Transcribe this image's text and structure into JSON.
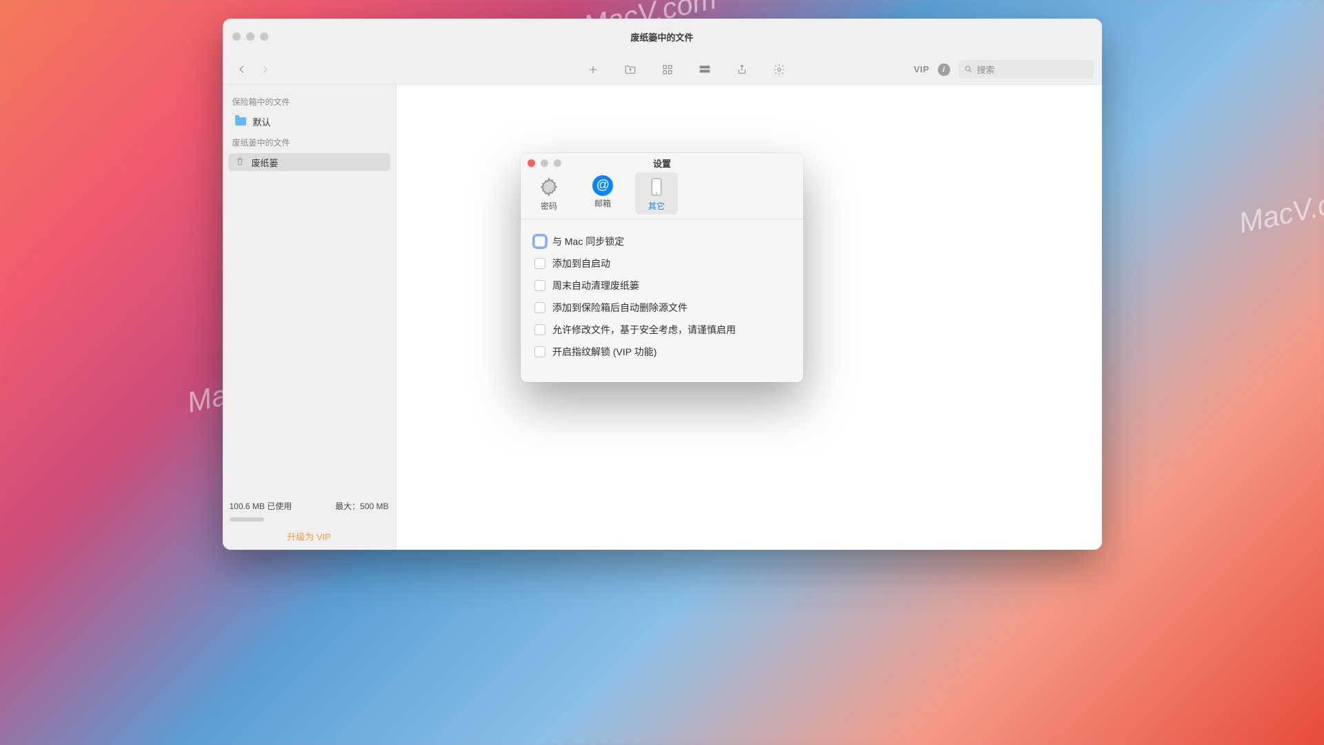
{
  "window": {
    "title": "废纸篓中的文件"
  },
  "toolbar": {
    "vip": "VIP",
    "search_placeholder": "搜索"
  },
  "sidebar": {
    "section_vault": "保险箱中的文件",
    "section_trash": "废纸篓中的文件",
    "item_default": "默认",
    "item_trash": "废纸篓",
    "usage_used": "100.6 MB 已使用",
    "usage_max": "最大：500 MB",
    "upgrade": "升级为 VIP"
  },
  "dialog": {
    "title": "设置",
    "tabs": {
      "password": "密码",
      "mail": "邮箱",
      "other": "其它"
    },
    "options": {
      "sync_lock": "与 Mac 同步锁定",
      "add_startup": "添加到自启动",
      "weekend_clean": "周末自动清理废纸篓",
      "delete_source": "添加到保险箱后自动删除源文件",
      "allow_modify": "允许修改文件，基于安全考虑，请谨慎启用",
      "touch_id": "开启指纹解锁 (VIP 功能)"
    }
  },
  "watermark": "MacV.com"
}
